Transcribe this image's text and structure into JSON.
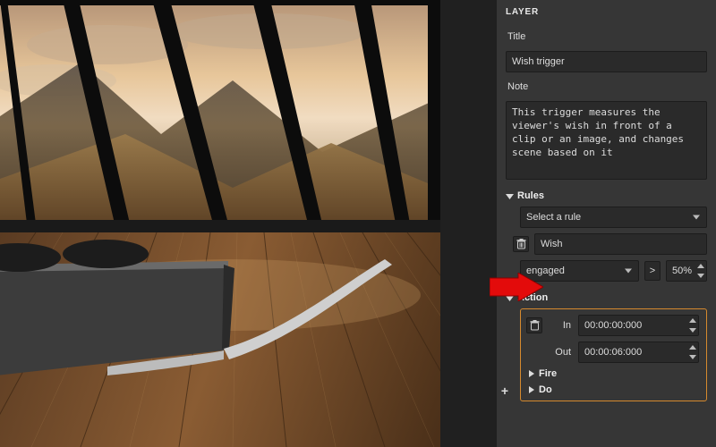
{
  "panel": {
    "header": "LAYER",
    "title_label": "Title",
    "title_value": "Wish trigger",
    "note_label": "Note",
    "note_value": "This trigger measures the viewer's wish in front of a clip or an image, and changes scene based on it"
  },
  "rules": {
    "header": "Rules",
    "select_placeholder": "Select a rule",
    "rule_name": "Wish",
    "condition_field": "engaged",
    "comparator": ">",
    "threshold": "50%"
  },
  "action": {
    "header": "Action",
    "in_label": "In",
    "in_value": "00:00:00:000",
    "out_label": "Out",
    "out_value": "00:00:06:000",
    "sub1": "Fire",
    "sub2": "Do"
  },
  "icons": {
    "trash": "trash-icon",
    "plus": "+"
  }
}
